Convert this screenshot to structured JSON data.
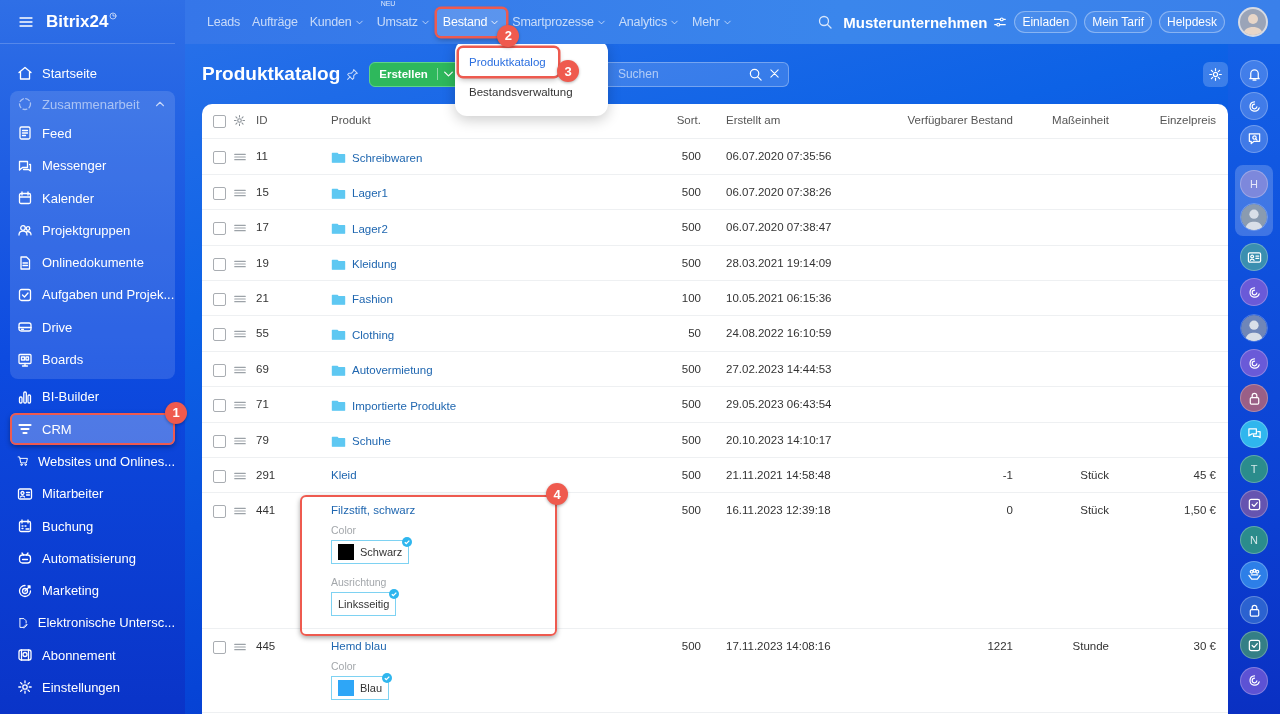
{
  "sidebar": {
    "logo": "Bitrix24",
    "items": [
      {
        "label": "Startseite",
        "kind": "item",
        "selected": false
      },
      {
        "label": "Zusammenarbeit",
        "kind": "group",
        "expanded": true,
        "children": [
          {
            "label": "Feed",
            "selected": false
          },
          {
            "label": "Messenger",
            "selected": false
          },
          {
            "label": "Kalender",
            "selected": false
          },
          {
            "label": "Projektgruppen",
            "selected": false
          },
          {
            "label": "Onlinedokumente",
            "selected": false
          },
          {
            "label": "Aufgaben und Projek...",
            "selected": false
          },
          {
            "label": "Drive",
            "selected": false
          },
          {
            "label": "Boards",
            "selected": false
          }
        ]
      },
      {
        "label": "BI-Builder",
        "kind": "item",
        "selected": false
      },
      {
        "label": "CRM",
        "kind": "item",
        "selected": true,
        "callout": "1"
      },
      {
        "label": "Websites und Onlines...",
        "kind": "item",
        "selected": false
      },
      {
        "label": "Mitarbeiter",
        "kind": "item",
        "selected": false
      },
      {
        "label": "Buchung",
        "kind": "item",
        "selected": false
      },
      {
        "label": "Automatisierung",
        "kind": "item",
        "selected": false
      },
      {
        "label": "Marketing",
        "kind": "item",
        "selected": false
      },
      {
        "label": "Elektronische Untersc...",
        "kind": "item",
        "selected": false
      },
      {
        "label": "Abonnement",
        "kind": "item",
        "selected": false
      },
      {
        "label": "Einstellungen",
        "kind": "item",
        "selected": false
      }
    ]
  },
  "topbar": {
    "nav": [
      {
        "label": "Leads",
        "menu": false,
        "selected": false
      },
      {
        "label": "Aufträge",
        "menu": false,
        "selected": false
      },
      {
        "label": "Kunden",
        "menu": true,
        "selected": false
      },
      {
        "label": "Umsatz",
        "menu": true,
        "selected": false,
        "badge": "NEU"
      },
      {
        "label": "Bestand",
        "menu": true,
        "selected": true,
        "callout": "2"
      },
      {
        "label": "Smartprozesse",
        "menu": true,
        "selected": false
      },
      {
        "label": "Analytics",
        "menu": true,
        "selected": false
      },
      {
        "label": "Mehr",
        "menu": true,
        "selected": false
      }
    ],
    "company": "Musterunternehmen",
    "buttons": [
      "Einladen",
      "Mein Tarif",
      "Helpdesk"
    ]
  },
  "dropdown": {
    "items": [
      {
        "label": "Produktkatalog",
        "selected": true,
        "callout": "3"
      },
      {
        "label": "Bestandsverwaltung",
        "selected": false
      }
    ]
  },
  "toolbar": {
    "title": "Produktkatalog",
    "create_button": "Erstellen",
    "search": {
      "placeholder": "Suchen"
    }
  },
  "table": {
    "select_all_checked": false,
    "columns": [
      "ID",
      "Produkt",
      "Sort.",
      "Erstellt am",
      "Verfügbarer Bestand",
      "Maßeinheit",
      "Einzelpreis"
    ],
    "rows": [
      {
        "checked": false,
        "id": "11",
        "kind": "folder",
        "product": "Schreibwaren",
        "sort": "500",
        "created": "06.07.2020 07:35:56"
      },
      {
        "checked": false,
        "id": "15",
        "kind": "folder",
        "product": "Lager1",
        "sort": "500",
        "created": "06.07.2020 07:38:26"
      },
      {
        "checked": false,
        "id": "17",
        "kind": "folder",
        "product": "Lager2",
        "sort": "500",
        "created": "06.07.2020 07:38:47"
      },
      {
        "checked": false,
        "id": "19",
        "kind": "folder",
        "product": "Kleidung",
        "sort": "500",
        "created": "28.03.2021 19:14:09"
      },
      {
        "checked": false,
        "id": "21",
        "kind": "folder",
        "product": "Fashion",
        "sort": "100",
        "created": "10.05.2021 06:15:36"
      },
      {
        "checked": false,
        "id": "55",
        "kind": "folder",
        "product": "Clothing",
        "sort": "50",
        "created": "24.08.2022 16:10:59"
      },
      {
        "checked": false,
        "id": "69",
        "kind": "folder",
        "product": "Autovermietung",
        "sort": "500",
        "created": "27.02.2023 14:44:53"
      },
      {
        "checked": false,
        "id": "71",
        "kind": "folder",
        "product": "Importierte Produkte",
        "sort": "500",
        "created": "29.05.2023 06:43:54"
      },
      {
        "checked": false,
        "id": "79",
        "kind": "folder",
        "product": "Schuhe",
        "sort": "500",
        "created": "20.10.2023 14:10:17"
      },
      {
        "checked": false,
        "id": "291",
        "kind": "product",
        "product": "Kleid",
        "sort": "500",
        "created": "21.11.2021 14:58:48",
        "stock": "-1",
        "unit": "Stück",
        "price": "45 €"
      },
      {
        "checked": false,
        "id": "441",
        "kind": "product",
        "product": "Filzstift, schwarz",
        "sort": "500",
        "created": "16.11.2023 12:39:18",
        "stock": "0",
        "unit": "Stück",
        "price": "1,50 €",
        "callout": "4",
        "properties": [
          {
            "label": "Color",
            "value": "Schwarz",
            "color": "#000000",
            "selected": true
          },
          {
            "label": "Ausrichtung",
            "value": "Linksseitig",
            "selected": true
          }
        ]
      },
      {
        "checked": false,
        "id": "445",
        "kind": "product",
        "product": "Hemd blau",
        "sort": "500",
        "created": "17.11.2023 14:08:16",
        "stock": "1221",
        "unit": "Stunde",
        "price": "30 €",
        "properties": [
          {
            "label": "Color",
            "value": "Blau",
            "color": "#2ea6f7",
            "selected": true
          }
        ]
      }
    ]
  },
  "right_bar": {
    "top": [
      {
        "kind": "icon"
      },
      {
        "kind": "icon"
      },
      {
        "kind": "icon"
      }
    ],
    "pinned": [
      {
        "kind": "letter",
        "text": "H",
        "color": "#7d88dc"
      },
      {
        "kind": "avatar",
        "color": "#8a9bb0"
      }
    ],
    "chats": [
      {
        "kind": "icon",
        "color": "#3a8fb0"
      },
      {
        "kind": "icon",
        "color": "#6a5ad8"
      },
      {
        "kind": "avatar",
        "color": "#6f86b8"
      },
      {
        "kind": "icon",
        "color": "#6a5ad8"
      },
      {
        "kind": "icon",
        "color": "#9a5f86"
      },
      {
        "kind": "icon",
        "color": "#2fb6ee"
      },
      {
        "kind": "letter",
        "text": "T",
        "color": "#2b8c8c"
      },
      {
        "kind": "icon",
        "color": "#6554b0"
      },
      {
        "kind": "letter",
        "text": "N",
        "color": "#2b8c8c"
      },
      {
        "kind": "icon",
        "color": "#2d7fe8"
      },
      {
        "kind": "icon",
        "color": "#2b62d0"
      },
      {
        "kind": "icon",
        "color": "#347f86"
      },
      {
        "kind": "icon",
        "color": "#5d52d4"
      }
    ]
  }
}
